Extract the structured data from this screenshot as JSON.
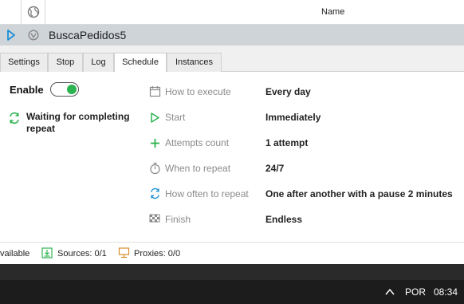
{
  "header": {
    "name_col": "Name"
  },
  "project": {
    "title": "BuscaPedidos5"
  },
  "tabs": [
    {
      "label": "Settings"
    },
    {
      "label": "Stop"
    },
    {
      "label": "Log"
    },
    {
      "label": "Schedule",
      "active": true
    },
    {
      "label": "Instances"
    }
  ],
  "schedule": {
    "enable_label": "Enable",
    "enabled": true,
    "status_text": "Waiting for completing repeat",
    "props": [
      {
        "label": "How to execute",
        "value": "Every day",
        "icon": "calendar-icon"
      },
      {
        "label": "Start",
        "value": "Immediately",
        "icon": "play-icon"
      },
      {
        "label": "Attempts count",
        "value": "1 attempt",
        "icon": "plus-icon"
      },
      {
        "label": "When to repeat",
        "value": "24/7",
        "icon": "stopwatch-icon"
      },
      {
        "label": "How often to repeat",
        "value": "One after another with a pause 2 minutes",
        "icon": "repeat-icon"
      },
      {
        "label": "Finish",
        "value": "Endless",
        "icon": "checkered-flag-icon"
      }
    ]
  },
  "statusbar": {
    "available": "vailable",
    "sources": "Sources: 0/1",
    "proxies": "Proxies: 0/0"
  },
  "taskbar": {
    "lang": "POR",
    "time": "08:34"
  },
  "colors": {
    "accent_green": "#2bb34f",
    "toggle_knob": "#2bb34f",
    "play_blue": "#1f8fd6"
  }
}
